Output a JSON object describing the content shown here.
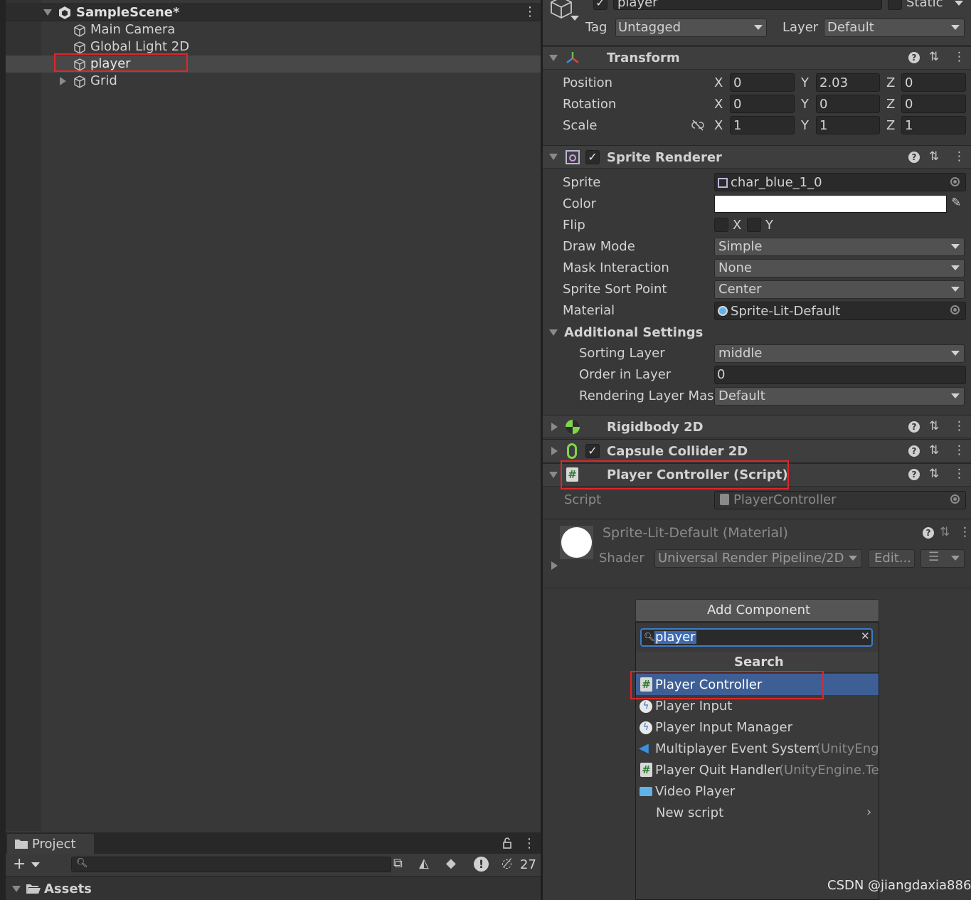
{
  "hierarchy": {
    "scene_name": "SampleScene*",
    "items": [
      {
        "label": "Main Camera"
      },
      {
        "label": "Global Light 2D"
      },
      {
        "label": "player"
      },
      {
        "label": "Grid"
      }
    ]
  },
  "project": {
    "tab_label": "Project",
    "hidden_count": "27",
    "assets_label": "Assets"
  },
  "inspector": {
    "object_name": "player",
    "static_label": "Static",
    "tag_label": "Tag",
    "tag_value": "Untagged",
    "layer_label": "Layer",
    "layer_value": "Default",
    "transform": {
      "title": "Transform",
      "position_label": "Position",
      "rotation_label": "Rotation",
      "scale_label": "Scale",
      "axis_x": "X",
      "axis_y": "Y",
      "axis_z": "Z",
      "position": [
        "0",
        "2.03",
        "0"
      ],
      "rotation": [
        "0",
        "0",
        "0"
      ],
      "scale": [
        "1",
        "1",
        "1"
      ]
    },
    "sprite_renderer": {
      "title": "Sprite Renderer",
      "sprite_label": "Sprite",
      "sprite_value": "char_blue_1_0",
      "color_label": "Color",
      "flip_label": "Flip",
      "flip_x": "X",
      "flip_y": "Y",
      "draw_mode_label": "Draw Mode",
      "draw_mode_value": "Simple",
      "mask_label": "Mask Interaction",
      "mask_value": "None",
      "sort_point_label": "Sprite Sort Point",
      "sort_point_value": "Center",
      "material_label": "Material",
      "material_value": "Sprite-Lit-Default",
      "additional_label": "Additional Settings",
      "sorting_layer_label": "Sorting Layer",
      "sorting_layer_value": "middle",
      "order_label": "Order in Layer",
      "order_value": "0",
      "rendering_mask_label": "Rendering Layer Mas",
      "rendering_mask_value": "Default"
    },
    "rigidbody": {
      "title": "Rigidbody 2D"
    },
    "capsule": {
      "title": "Capsule Collider 2D"
    },
    "player_controller": {
      "title": "Player Controller (Script)",
      "script_label": "Script",
      "script_value": "PlayerController"
    },
    "material": {
      "title": "Sprite-Lit-Default (Material)",
      "shader_label": "Shader",
      "shader_value": "Universal Render Pipeline/2D/",
      "edit_label": "Edit..."
    }
  },
  "add_component": {
    "button_label": "Add Component",
    "search_value": "player",
    "header": "Search",
    "items": [
      {
        "label": "Player Controller",
        "suffix": ""
      },
      {
        "label": "Player Input",
        "suffix": ""
      },
      {
        "label": "Player Input Manager",
        "suffix": ""
      },
      {
        "label": "Multiplayer Event System",
        "suffix": "(UnityEngi"
      },
      {
        "label": "Player Quit Handler",
        "suffix": "(UnityEngine.Te"
      },
      {
        "label": "Video Player",
        "suffix": ""
      },
      {
        "label": "New script",
        "suffix": ""
      }
    ]
  },
  "watermark": "CSDN @jiangdaxia886"
}
